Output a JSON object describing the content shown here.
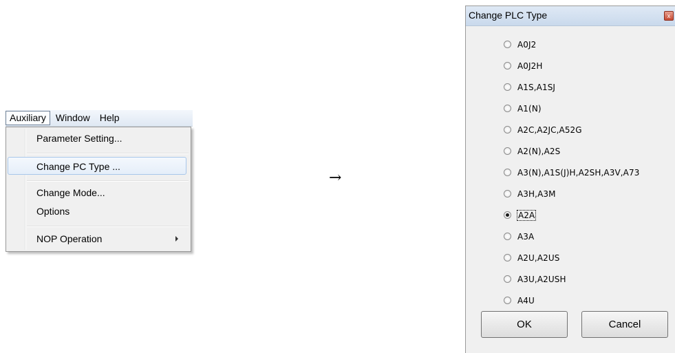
{
  "menubar": {
    "items": [
      "Auxiliary",
      "Window",
      "Help"
    ]
  },
  "menu": {
    "items": [
      {
        "label": "Parameter Setting..."
      },
      {
        "label": "Change PC Type ..."
      },
      {
        "label": "Change Mode..."
      },
      {
        "label": "Options"
      },
      {
        "label": "NOP Operation"
      }
    ],
    "highlighted": "Change PC Type ..."
  },
  "transition_arrow": "→",
  "dialog": {
    "title": "Change PLC Type",
    "close_glyph": "x",
    "options": [
      "A0J2",
      "A0J2H",
      "A1S,A1SJ",
      "A1(N)",
      "A2C,A2JC,A52G",
      "A2(N),A2S",
      "A3(N),A1S(J)H,A2SH,A3V,A73",
      "A3H,A3M",
      "A2A",
      "A3A",
      "A2U,A2US",
      "A3U,A2USH",
      "A4U"
    ],
    "selected": "A2A",
    "ok_label": "OK",
    "cancel_label": "Cancel"
  }
}
